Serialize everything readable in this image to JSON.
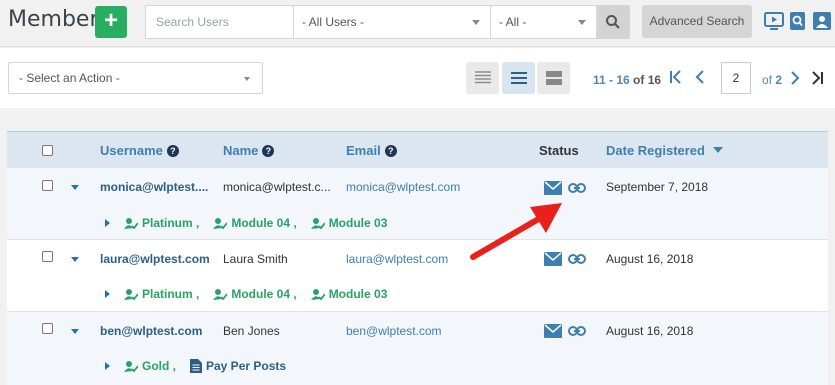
{
  "header": {
    "title": "Members",
    "add_label": "+",
    "search_placeholder": "Search Users",
    "filter_users": "- All Users -",
    "filter_all": "- All -",
    "advanced_search": "Advanced Search",
    "icons": [
      "video-icon",
      "search-doc-icon",
      "user-card-icon"
    ]
  },
  "actions": {
    "select_action": "- Select an Action -"
  },
  "pager": {
    "range": "11 - 16",
    "of_label": "of",
    "total": "16",
    "page": "2",
    "of_pages_label": "of",
    "pages": "2"
  },
  "table": {
    "columns": {
      "username": "Username",
      "name": "Name",
      "email": "Email",
      "status": "Status",
      "date": "Date Registered"
    },
    "rows": [
      {
        "username": "monica@wlptest....",
        "name": "monica@wlptest.c...",
        "email": "monica@wlptest.com",
        "date": "September 7, 2018",
        "levels": [
          {
            "label": "Platinum ,",
            "type": "level"
          },
          {
            "label": "Module 04 ,",
            "type": "level"
          },
          {
            "label": "Module 03",
            "type": "level"
          }
        ]
      },
      {
        "username": "laura@wlptest.com",
        "name": "Laura Smith",
        "email": "laura@wlptest.com",
        "date": "August 16, 2018",
        "levels": [
          {
            "label": "Platinum ,",
            "type": "level"
          },
          {
            "label": "Module 04 ,",
            "type": "level"
          },
          {
            "label": "Module 03",
            "type": "level"
          }
        ]
      },
      {
        "username": "ben@wlptest.com",
        "name": "Ben Jones",
        "email": "ben@wlptest.com",
        "date": "August 16, 2018",
        "levels": [
          {
            "label": "Gold ,",
            "type": "level"
          },
          {
            "label": "Pay Per Posts",
            "type": "post"
          }
        ]
      }
    ]
  },
  "colors": {
    "accent_green": "#27ae60",
    "link_blue": "#3e7fb0",
    "level_green": "#2aa267",
    "annotation_red": "#e8211b"
  }
}
